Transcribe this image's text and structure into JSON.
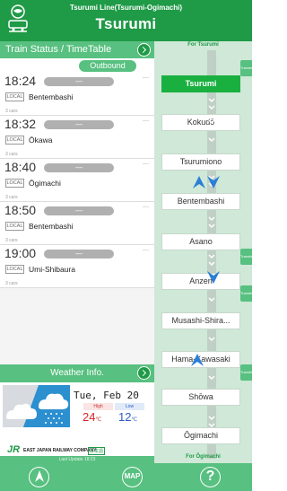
{
  "header": {
    "line_name": "Tsurumi Line(Tsurumi-Ogimachi)",
    "station": "Tsurumi"
  },
  "timetable": {
    "section_title": "Train Status / TimeTable",
    "direction": "Outbound",
    "trains": [
      {
        "time": "18:24",
        "status": "—",
        "type": "LOCAL",
        "destination": "Bentembashi",
        "cars": "3 cars"
      },
      {
        "time": "18:32",
        "status": "—",
        "type": "LOCAL",
        "destination": "Ōkawa",
        "cars": "3 cars"
      },
      {
        "time": "18:40",
        "status": "—",
        "type": "LOCAL",
        "destination": "Ōgimachi",
        "cars": "3 cars"
      },
      {
        "time": "18:50",
        "status": "—",
        "type": "LOCAL",
        "destination": "Bentembashi",
        "cars": "3 cars"
      },
      {
        "time": "19:00",
        "status": "—",
        "type": "LOCAL",
        "destination": "Umi-Shibaura",
        "cars": "3 cars"
      }
    ]
  },
  "weather": {
    "section_title": "Weather Info.",
    "date": "Tue, Feb 20",
    "high_label": "High",
    "low_label": "Low",
    "high": "24",
    "low": "12",
    "unit": "℃",
    "icon": "cloudy-rain-icon"
  },
  "footer_left": {
    "company": "EAST JAPAN RAILWAY COMPANY",
    "jr_mark": "JR",
    "lang": "日本語",
    "last_update": "Last Update 18:23"
  },
  "route": {
    "top_label": "For Tsurumi",
    "bottom_label": "For Ōgimachi",
    "transfer_label": "Transfer",
    "stations": [
      {
        "name": "Tsurumi",
        "current": true,
        "transfer": true
      },
      {
        "name": "Kokudō",
        "current": false,
        "transfer": false
      },
      {
        "name": "Tsurumiono",
        "current": false,
        "transfer": false
      },
      {
        "name": "Bentembashi",
        "current": false,
        "transfer": false
      },
      {
        "name": "Asano",
        "current": false,
        "transfer": true
      },
      {
        "name": "Anzen",
        "current": false,
        "transfer": false
      },
      {
        "name": "Musashi-Shira...",
        "current": false,
        "transfer": true
      },
      {
        "name": "Hama-Kawasaki",
        "current": false,
        "transfer": true
      },
      {
        "name": "Shōwa",
        "current": false,
        "transfer": false
      },
      {
        "name": "Ōgimachi",
        "current": false,
        "transfer": false
      }
    ]
  },
  "bottom_bar": {
    "map_label": "MAP",
    "help_label": "?"
  },
  "colors": {
    "brand_green": "#1f9a47",
    "light_green": "#58c080",
    "current_station": "#1ab040",
    "train_marker": "#2a7fd6"
  }
}
